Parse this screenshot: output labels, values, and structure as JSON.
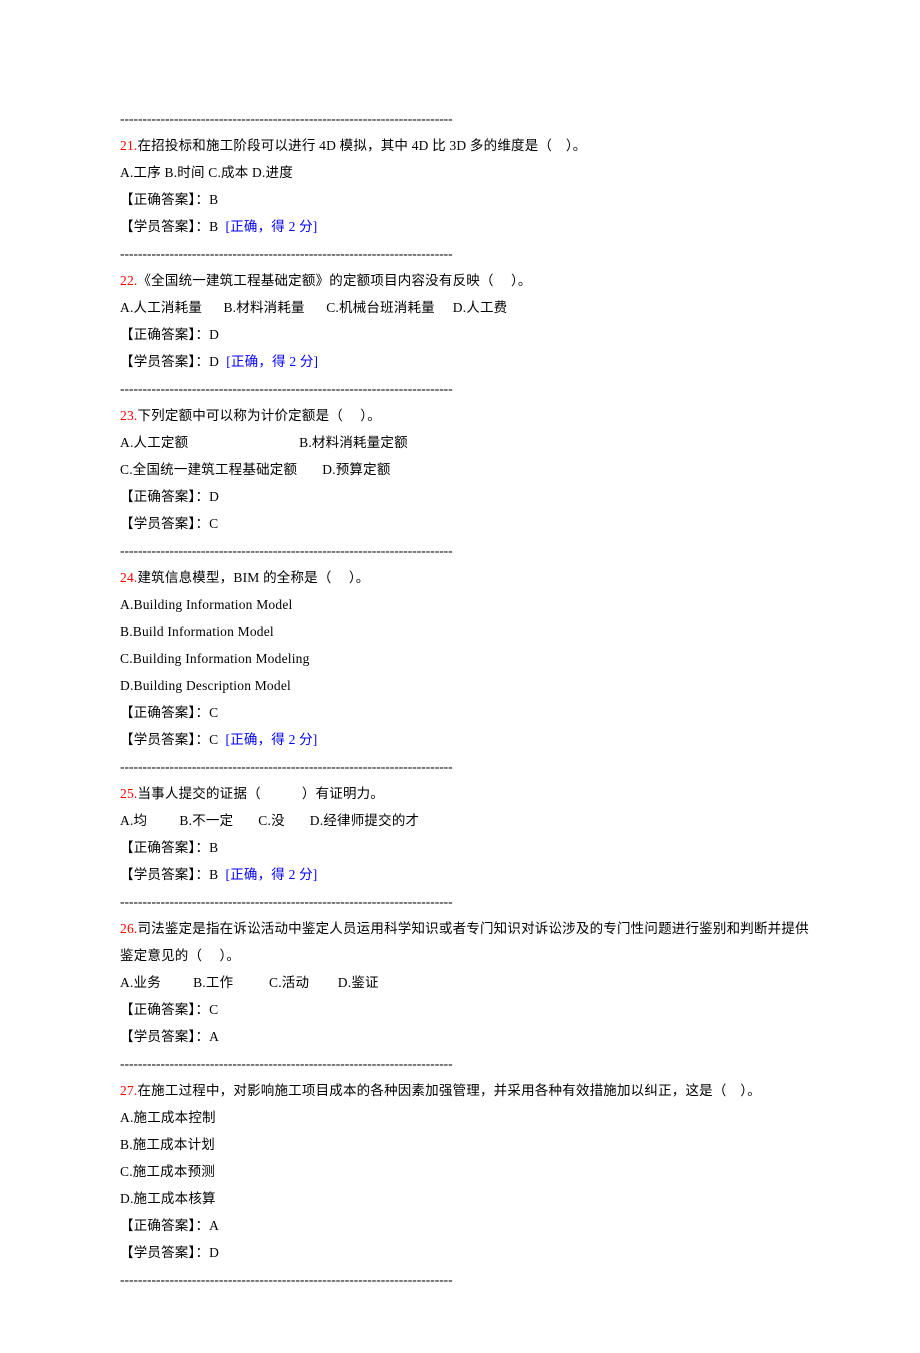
{
  "sep": "--------------------------------------------------------------------------",
  "q21": {
    "num": "21.",
    "stem": "在招投标和施工阶段可以进行 4D 模拟，其中 4D 比 3D 多的维度是（　）。",
    "opts": "A.工序 B.时间 C.成本 D.进度",
    "correct": "【正确答案】：B",
    "student_prefix": "【学员答案】：B  ",
    "feedback": "[正确，得 2 分]"
  },
  "q22": {
    "num": "22.",
    "stem": "《全国统一建筑工程基础定额》的定额项目内容没有反映（　 ）。",
    "opts": "A.人工消耗量      B.材料消耗量      C.机械台班消耗量     D.人工费",
    "correct": "【正确答案】：D",
    "student_prefix": "【学员答案】：D  ",
    "feedback": "[正确，得 2 分]"
  },
  "q23": {
    "num": "23.",
    "stem": "下列定额中可以称为计价定额是（　 ）。",
    "opts1": "A.人工定额                               B.材料消耗量定额",
    "opts2": "C.全国统一建筑工程基础定额       D.预算定额",
    "correct": "【正确答案】：D",
    "student": "【学员答案】：C"
  },
  "q24": {
    "num": "24.",
    "stem": "建筑信息模型，BIM 的全称是（　 ）。",
    "a": "A.Building Information Model",
    "b": "B.Build Information Model",
    "c": "C.Building Information Modeling",
    "d": "D.Building Description Model",
    "correct": "【正确答案】：C",
    "student_prefix": "【学员答案】：C  ",
    "feedback": "[正确，得 2 分]"
  },
  "q25": {
    "num": "25.",
    "stem": "当事人提交的证据（　　　）有证明力。",
    "opts": "A.均         B.不一定       C.没       D.经律师提交的才",
    "correct": "【正确答案】：B",
    "student_prefix": "【学员答案】：B  ",
    "feedback": "[正确，得 2 分]"
  },
  "q26": {
    "num": "26.",
    "stem": "司法鉴定是指在诉讼活动中鉴定人员运用科学知识或者专门知识对诉讼涉及的专门性问题进行鉴别和判断并提供鉴定意见的（　 ）。",
    "opts": "A.业务         B.工作          C.活动        D.鉴证",
    "correct": "【正确答案】：C",
    "student": "【学员答案】：A"
  },
  "q27": {
    "num": "27.",
    "stem": "在施工过程中，对影响施工项目成本的各种因素加强管理，并采用各种有效措施加以纠正，这是（　）。",
    "a": "A.施工成本控制",
    "b": "B.施工成本计划",
    "c": "C.施工成本预测",
    "d": "D.施工成本核算",
    "correct": "【正确答案】：A",
    "student": "【学员答案】：D"
  }
}
